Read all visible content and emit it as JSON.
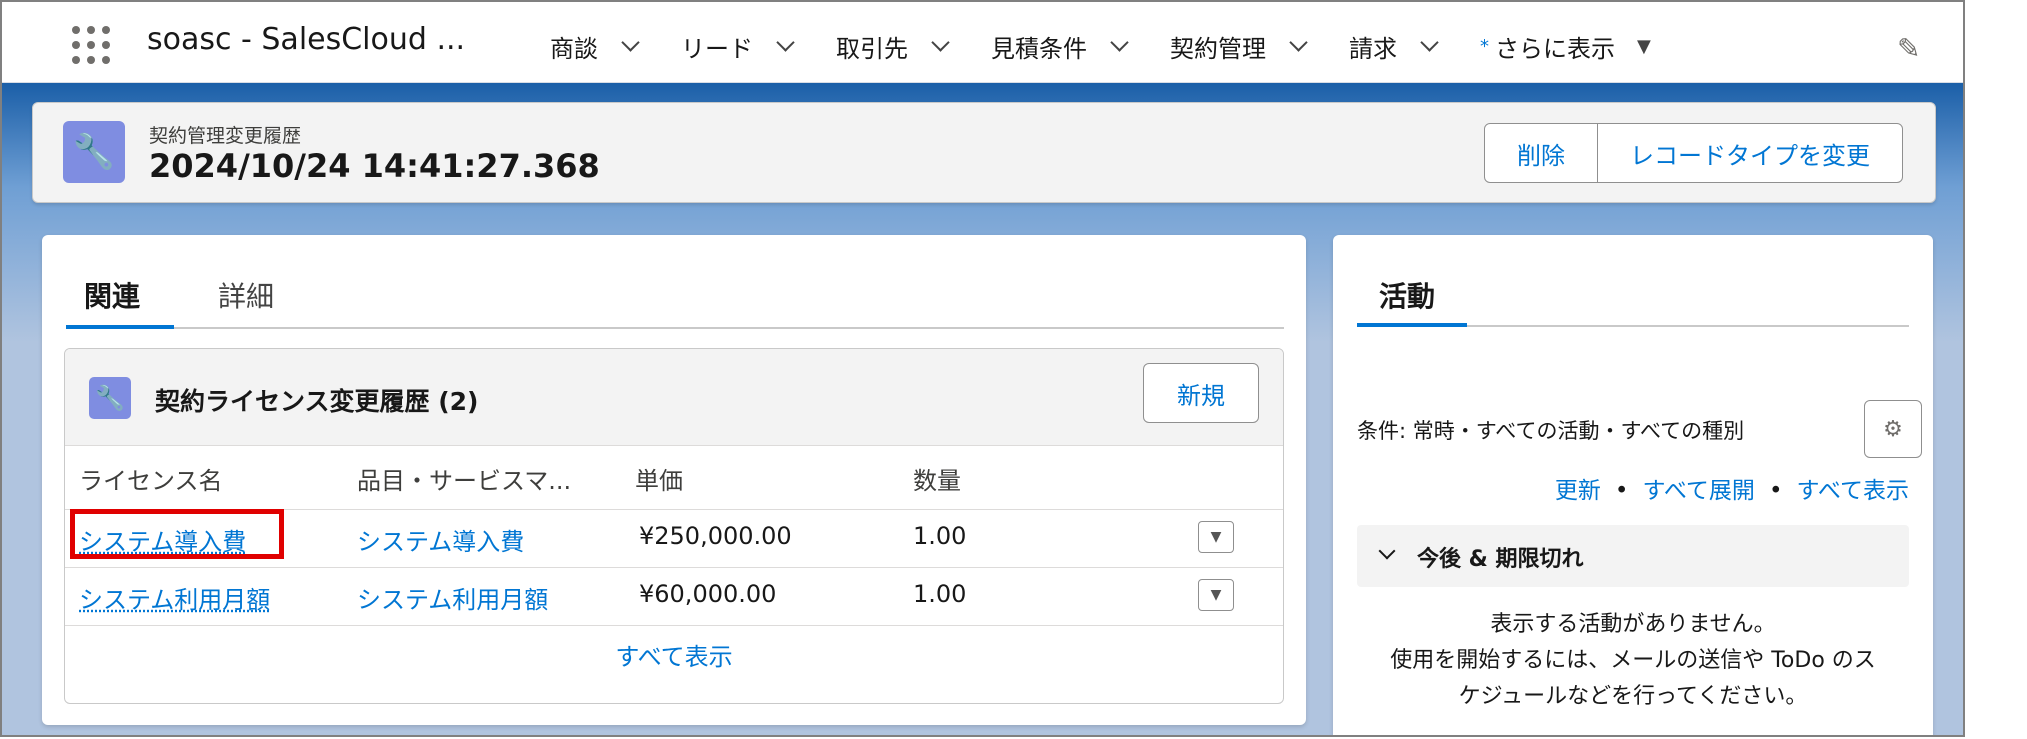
{
  "nav": {
    "app_name": "soasc - SalesCloud ...",
    "items": [
      {
        "label": "商談"
      },
      {
        "label": "リード"
      },
      {
        "label": "取引先"
      },
      {
        "label": "見積条件"
      },
      {
        "label": "契約管理"
      },
      {
        "label": "請求"
      }
    ],
    "more_star": "*",
    "more_label": "さらに表示"
  },
  "header": {
    "object_label": "契約管理変更履歴",
    "record_name": "2024/10/24 14:41:27.368",
    "buttons": {
      "delete": "削除",
      "change_record_type": "レコードタイプを変更"
    }
  },
  "left_tabs": {
    "related": "関連",
    "details": "詳細"
  },
  "related_list": {
    "title": "契約ライセンス変更履歴 (2)",
    "new_button": "新規",
    "columns": [
      "ライセンス名",
      "品目・サービスマ...",
      "単価",
      "数量"
    ],
    "rows": [
      {
        "license": "システム導入費",
        "item": "システム導入費",
        "price": "¥250,000.00",
        "qty": "1.00"
      },
      {
        "license": "システム利用月額",
        "item": "システム利用月額",
        "price": "¥60,000.00",
        "qty": "1.00"
      }
    ],
    "view_all": "すべて表示"
  },
  "activity": {
    "tab": "活動",
    "filter": "条件: 常時・すべての活動・すべての種別",
    "links": {
      "refresh": "更新",
      "expand_all": "すべて展開",
      "view_all": "すべて表示"
    },
    "dot": "•",
    "section": "今後 & 期限切れ",
    "empty_line1": "表示する活動がありません。",
    "empty_line2": "使用を開始するには、メールの送信や ToDo のス",
    "empty_line3": "ケジュールなどを行ってください。"
  }
}
